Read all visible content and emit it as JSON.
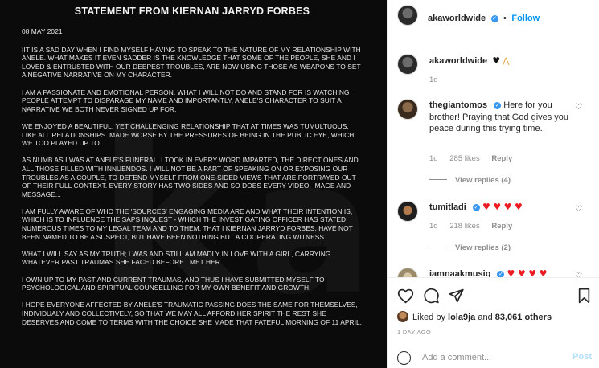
{
  "statement": {
    "title": "STATEMENT FROM KIERNAN JARRYD FORBES",
    "date": "08 MAY 2021",
    "paragraphs": [
      "IIT IS A SAD DAY WHEN I FIND MYSELF HAVING TO SPEAK TO THE NATURE OF MY RELATIONSHIP WITH ANELE. WHAT MAKES IT EVEN SADDER IS THE KNOWLEDGE THAT SOME OF THE PEOPLE, SHE AND I LOVED & ENTRUSTED WITH OUR DEEPEST TROUBLES, ARE NOW USING THOSE AS WEAPONS TO SET A NEGATIVE NARRATIVE ON MY CHARACTER.",
      "I AM A PASSIONATE AND EMOTIONAL PERSON. WHAT I WILL NOT DO AND STAND FOR IS WATCHING PEOPLE ATTEMPT TO DISPARAGE MY NAME AND IMPORTANTLY, ANELE'S CHARACTER TO SUIT A NARRATIVE WE BOTH NEVER SIGNED UP FOR.",
      "WE ENJOYED A BEAUTIFUL, YET CHALLENGING RELATIONSHIP THAT AT TIMES WAS TUMULTUOUS, LIKE ALL RELATIONSHIPS. MADE WORSE BY THE PRESSURES OF BEING IN THE PUBLIC EYE, WHICH WE TOO PLAYED UP TO.",
      "AS NUMB AS I WAS AT ANELE'S FUNERAL, I TOOK IN EVERY WORD IMPARTED, THE DIRECT ONES AND ALL THOSE FILLED WITH INNUENDOS. I WILL NOT BE A PART OF SPEAKING ON OR EXPOSING OUR TROUBLES AS A COUPLE, TO DEFEND MYSELF FROM ONE-SIDED VIEWS THAT ARE PORTRAYED OUT OF THEIR FULL CONTEXT. EVERY STORY HAS TWO SIDES AND SO DOES EVERY VIDEO, IMAGE AND MESSAGE...",
      "I AM FULLY AWARE OF WHO THE 'SOURCES' ENGAGING MEDIA ARE AND WHAT THEIR INTENTION IS, WHICH IS TO INFLUENCE THE SAPS INQUEST - WHICH THE INVESTIGATING OFFICER HAS STATED NUMEROUS TIMES TO MY LEGAL TEAM AND TO THEM, THAT I KIERNAN JARRYD FORBES, HAVE NOT BEEN NAMED TO BE A SUSPECT, BUT HAVE BEEN NOTHING BUT A COOPERATING WITNESS.",
      "WHAT I WILL SAY AS MY TRUTH; I WAS AND STILL AM MADLY IN LOVE WITH A GIRL, CARRYING WHATEVER PAST TRAUMAS SHE FACED BEFORE I MET HER.",
      " I OWN UP TO MY PAST AND CURRENT TRAUMAS, AND THUS I HAVE SUBMITTED MYSELF TO PSYCHOLOGICAL AND SPIRITUAL COUNSELLING FOR MY OWN BENEFIT AND GROWTH.",
      "I HOPE EVERYONE AFFECTED BY ANELE'S TRAUMATIC PASSING DOES THE SAME FOR THEMSELVES, INDIVIDUALY AND COLLECTIVELY, SO THAT WE MAY ALL AFFORD HER SPIRIT THE REST SHE DESERVES AND COME TO TERMS WITH THE CHOICE SHE MADE THAT FATEFUL MORNING OF 11 APRIL."
    ]
  },
  "header": {
    "username": "akaworldwide",
    "separator": "•",
    "follow_label": "Follow"
  },
  "caption": {
    "username": "akaworldwide",
    "time": "1d"
  },
  "comments": [
    {
      "username": "thegiantomos",
      "text": "Here for you brother! Praying that God gives you peace during this trying time.",
      "time": "1d",
      "likes": "285 likes",
      "reply_label": "Reply",
      "view_replies": "View replies (4)"
    },
    {
      "username": "tumitladi",
      "time": "1d",
      "likes": "218 likes",
      "reply_label": "Reply",
      "view_replies": "View replies (2)"
    },
    {
      "username": "iamnaakmusiq"
    }
  ],
  "footer": {
    "liked_by_prefix": "Liked by ",
    "liked_by_user": "lola9ja",
    "liked_by_mid": " and ",
    "liked_by_count": "83,061 others",
    "time_ago": "1 DAY AGO",
    "comment_placeholder": "Add a comment...",
    "post_label": "Post"
  },
  "colors": {
    "accent_blue": "#0095f6",
    "verified_blue": "#3897f0",
    "heart_red": "#ed1c24",
    "statement_bg": "#0b0b0b"
  },
  "icons": [
    "verified-badge-icon",
    "heart-outline-icon",
    "comment-icon",
    "share-icon",
    "bookmark-icon",
    "emoji-icon",
    "black-heart-emoji",
    "praying-hands-emoji",
    "red-heart-emoji"
  ]
}
